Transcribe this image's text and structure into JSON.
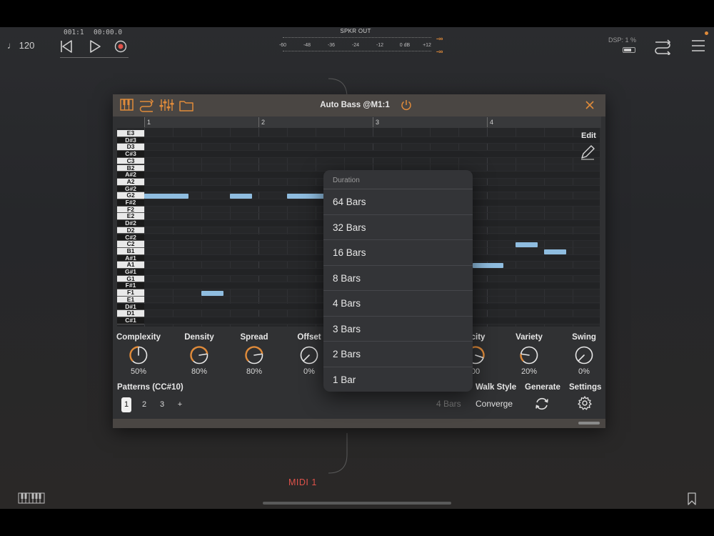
{
  "transport": {
    "tempo": "♩ 120",
    "position": "001:1",
    "time": "00:00.0"
  },
  "meter": {
    "title": "SPKR OUT",
    "scale": [
      "-60",
      "-48",
      "-36",
      "-24",
      "-12",
      "0 dB",
      "+12"
    ],
    "peak_top": "-∞",
    "peak_bottom": "-∞"
  },
  "status": {
    "dsp": "DSP: 1 %"
  },
  "plugin": {
    "title": "Auto Bass @M1:1",
    "ruler": [
      "1",
      "2",
      "3",
      "4"
    ],
    "edit_label": "Edit",
    "keys": [
      "E3",
      "D#3",
      "D3",
      "C#3",
      "C3",
      "B2",
      "A#2",
      "A2",
      "G#2",
      "G2",
      "F#2",
      "F2",
      "E2",
      "D#2",
      "D2",
      "C#2",
      "C2",
      "B1",
      "A#1",
      "A1",
      "G#1",
      "G1",
      "F#1",
      "F1",
      "E1",
      "D#1",
      "D1",
      "C#1"
    ],
    "knobs": [
      {
        "label": "Complexity",
        "value": "50%"
      },
      {
        "label": "Density",
        "value": "80%"
      },
      {
        "label": "Spread",
        "value": "80%"
      },
      {
        "label": "Offset",
        "value": "0%"
      },
      {
        "label": "ocity",
        "value": "00"
      },
      {
        "label": "Variety",
        "value": "20%"
      },
      {
        "label": "Swing",
        "value": "0%"
      }
    ],
    "patterns_label": "Patterns (CC#10)",
    "patterns": [
      "1",
      "2",
      "3",
      "+"
    ],
    "length_value": "4 Bars",
    "walk_style_label": "Walk Style",
    "walk_style_value": "Converge",
    "generate_label": "Generate",
    "settings_label": "Settings"
  },
  "dropdown": {
    "header": "Duration",
    "options": [
      "64 Bars",
      "32 Bars",
      "16 Bars",
      "8 Bars",
      "4 Bars",
      "3 Bars",
      "2 Bars",
      "1 Bar"
    ]
  },
  "track": {
    "midi_label": "MIDI 1"
  },
  "colors": {
    "accent": "#e08b3a",
    "note": "#8fbde0",
    "record": "#e0524a",
    "midi": "#e0524a"
  }
}
